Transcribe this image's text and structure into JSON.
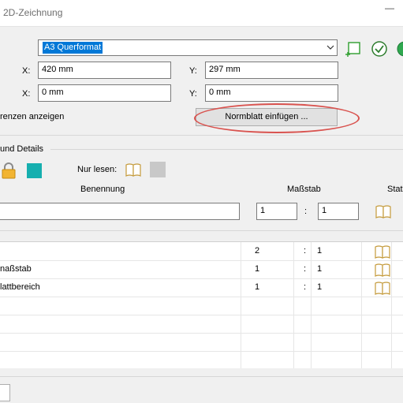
{
  "window": {
    "title": "2D-Zeichnung",
    "minimize_glyph": "—"
  },
  "format": {
    "selected": "A3 Querformat"
  },
  "size": {
    "x_label": "X:",
    "x_value": "420 mm",
    "y_label": "Y:",
    "y_value": "297 mm"
  },
  "offset": {
    "x_label": "X:",
    "x_value": "0 mm",
    "y_label": "Y:",
    "y_value": "0 mm"
  },
  "limits": {
    "checkbox_label": "renzen anzeigen",
    "normblatt_button": "Normblatt einfügen ..."
  },
  "details": {
    "section_title": "und Details",
    "read_only_label": "Nur lesen:",
    "teal_color": "#16afaf"
  },
  "table": {
    "headers": {
      "benennung": "Benennung",
      "massstab": "Maßstab",
      "status": "Stat"
    },
    "input_row": {
      "benennung": "",
      "scale_a": "1",
      "separator": ":",
      "scale_b": "1"
    },
    "rows": [
      {
        "name": "",
        "a": "2",
        "sep": ":",
        "b": "1"
      },
      {
        "name": "naßstab",
        "a": "1",
        "sep": ":",
        "b": "1"
      },
      {
        "name": "lattbereich",
        "a": "1",
        "sep": ":",
        "b": "1"
      }
    ]
  },
  "colors": {
    "accent": "#0078d7",
    "highlight_ellipse": "#d9534f",
    "confirm_green": "#1e8e3e"
  }
}
